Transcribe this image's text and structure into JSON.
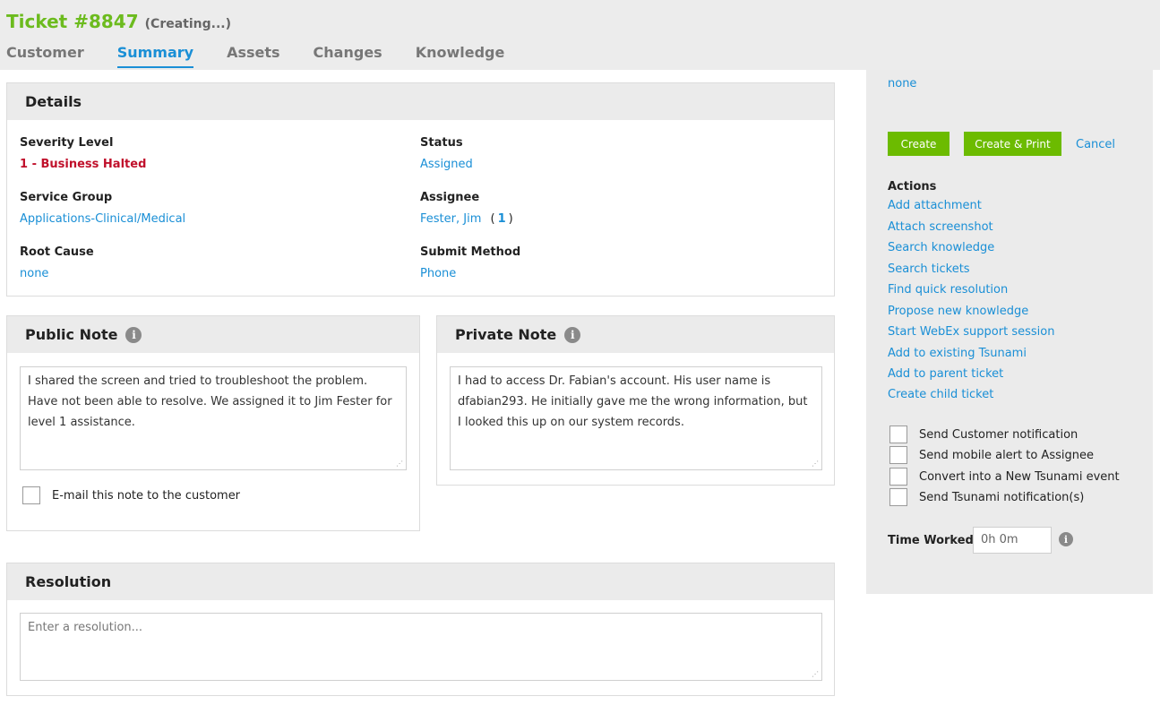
{
  "header": {
    "title": "Ticket #8847",
    "status": "(Creating...)",
    "tabs": [
      {
        "label": "Customer"
      },
      {
        "label": "Summary"
      },
      {
        "label": "Assets"
      },
      {
        "label": "Changes"
      },
      {
        "label": "Knowledge"
      }
    ],
    "active_tab": "Summary"
  },
  "details": {
    "heading": "Details",
    "severity_label": "Severity Level",
    "severity_value": "1 - Business Halted",
    "status_label": "Status",
    "status_value": "Assigned",
    "service_group_label": "Service Group",
    "service_group_value": "Applications-Clinical/Medical",
    "assignee_label": "Assignee",
    "assignee_value": "Fester, Jim",
    "assignee_count_open": "(",
    "assignee_count": "1",
    "assignee_count_close": ")",
    "root_cause_label": "Root Cause",
    "root_cause_value": "none",
    "submit_method_label": "Submit Method",
    "submit_method_value": "Phone"
  },
  "public_note": {
    "heading": "Public Note",
    "text": "I shared the screen and tried to troubleshoot the problem.  Have not been able to resolve.  We assigned it to Jim Fester for level 1 assistance.",
    "email_label": "E-mail this note to the customer"
  },
  "private_note": {
    "heading": "Private Note",
    "text": "I had to access Dr. Fabian's account.  His user name is dfabian293.  He initially gave me the wrong information, but I looked this up on our system records."
  },
  "resolution": {
    "heading": "Resolution",
    "placeholder": "Enter a resolution..."
  },
  "sidebar": {
    "top_value": "none",
    "create_label": "Create",
    "create_print_label": "Create & Print",
    "cancel_label": "Cancel",
    "actions_title": "Actions",
    "actions": [
      {
        "label": "Add attachment"
      },
      {
        "label": "Attach screenshot"
      },
      {
        "label": "Search knowledge"
      },
      {
        "label": "Search tickets"
      },
      {
        "label": "Find quick resolution"
      },
      {
        "label": "Propose new knowledge"
      },
      {
        "label": "Start WebEx support session"
      },
      {
        "label": "Add to existing Tsunami"
      },
      {
        "label": "Add to parent ticket"
      },
      {
        "label": "Create child ticket"
      }
    ],
    "checks": [
      {
        "label": "Send Customer notification"
      },
      {
        "label": "Send mobile alert to Assignee"
      },
      {
        "label": "Convert into a New Tsunami event"
      },
      {
        "label": "Send Tsunami notification(s)"
      }
    ],
    "time_worked_label": "Time Worked:",
    "time_worked_value": "0h 0m"
  },
  "colors": {
    "brand_green": "#6cbb1e",
    "link_blue": "#1a8fd6",
    "severity_red": "#c0102b"
  },
  "icons": {
    "info": "info-icon",
    "resize": "resize-grip-icon"
  }
}
